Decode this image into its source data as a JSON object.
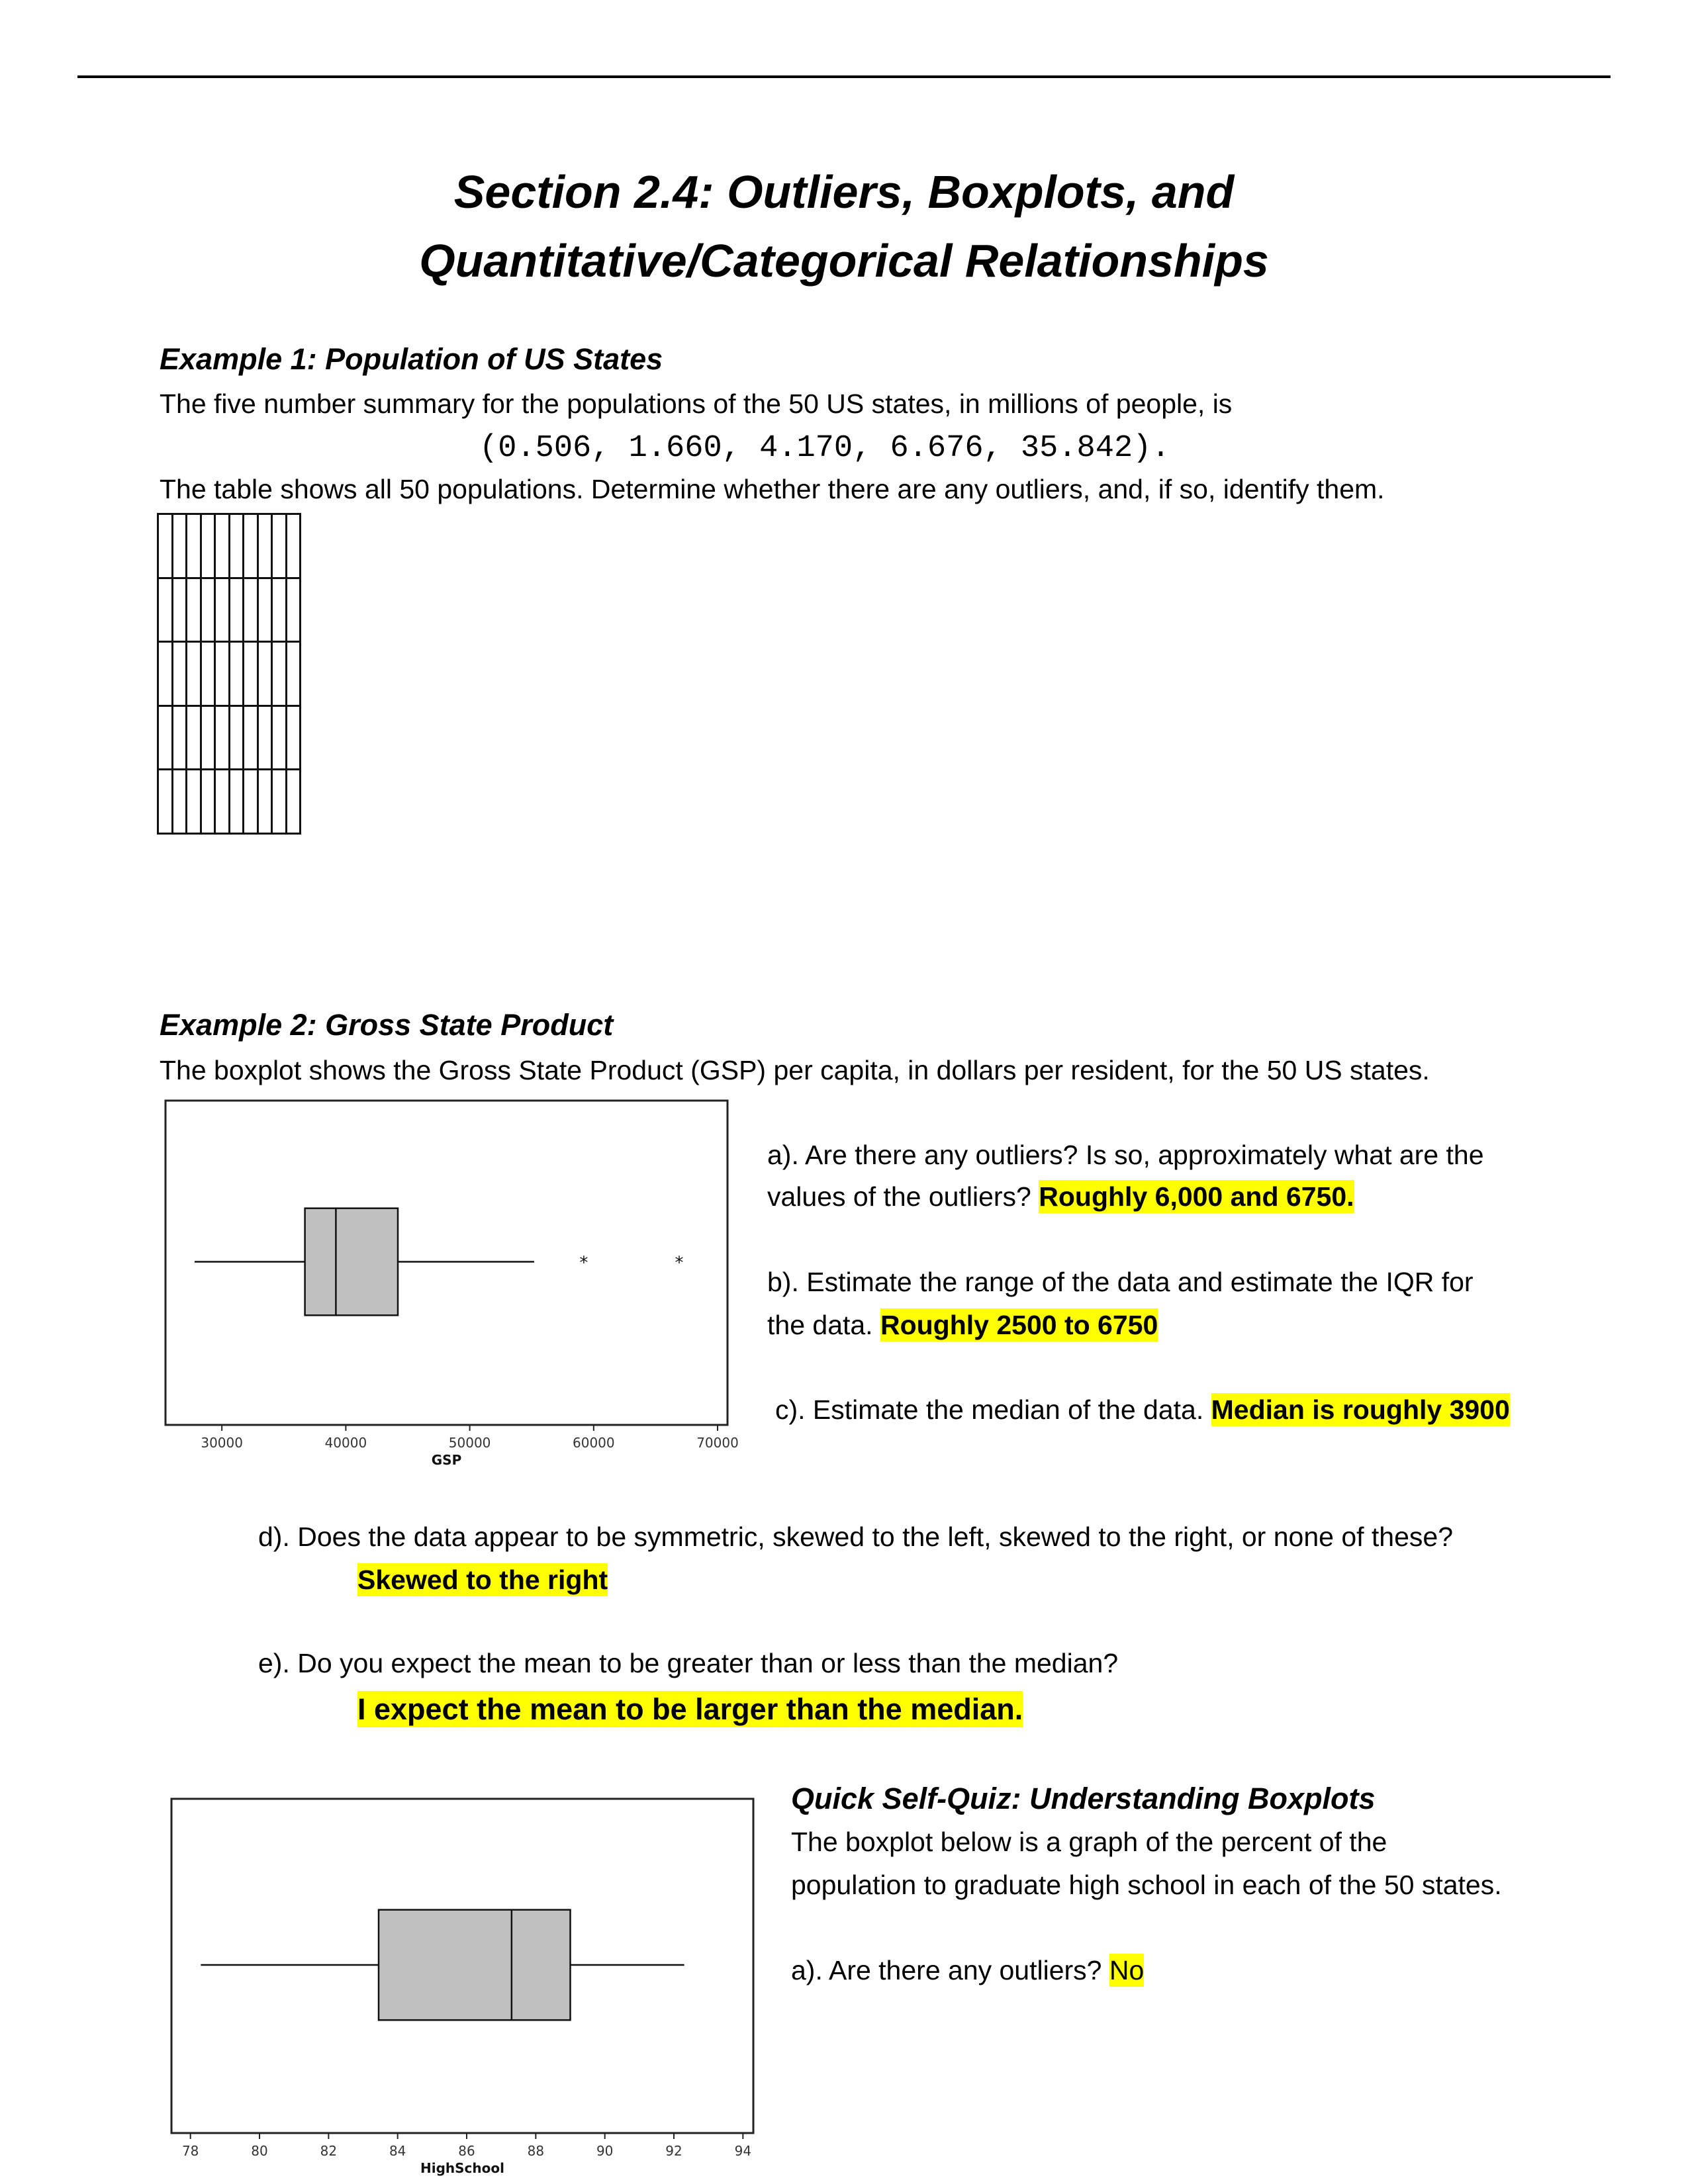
{
  "header": {
    "title_line1": "Section 2.4:  Outliers, Boxplots, and",
    "title_line2": "Quantitative/Categorical Relationships"
  },
  "example1": {
    "heading": "Example 1:  Population of US States",
    "intro": "The five number summary for the populations of the 50 US states, in millions of people, is",
    "five_number_summary": "(0.506, 1.660, 4.170, 6.676, 35.842).",
    "instruction": "The table shows all 50 populations.  Determine whether there are any outliers, and, if so, identify them.",
    "table": {
      "rows": 5,
      "columns": 10,
      "cells": []
    }
  },
  "example2": {
    "heading": "Example 2:  Gross State Product",
    "intro": "The boxplot shows the Gross State Product (GSP) per capita, in dollars per resident, for the 50 US states.",
    "questions": {
      "a_line1": "a).  Are there any outliers?  Is so, approximately what are the",
      "a_line2": "values of the outliers?",
      "a_answer": "Roughly 6,000 and 6750.",
      "b_line1": "b).  Estimate the range of the data and estimate the IQR for",
      "b_line2": "the data.",
      "b_answer": "Roughly 2500 to 6750",
      "c_text": "c).  Estimate the median of the data.",
      "c_answer": "Median is roughly 3900",
      "d_text": "d).  Does the data appear to be symmetric, skewed to the left, skewed to the right, or none of these?",
      "d_answer": "Skewed to the right",
      "e_text": "e).  Do you expect the mean to be greater than or less than the median?",
      "e_answer": "I expect the mean to be larger than the median."
    }
  },
  "quiz": {
    "heading": "Quick Self-Quiz:  Understanding Boxplots",
    "line1": "The boxplot below is a graph of the percent of the",
    "line2": "population to graduate high school in each of the 50 states.",
    "a_text": "a).  Are there any outliers?",
    "a_answer": "No"
  },
  "colors": {
    "highlight": "#ffff00",
    "box_fill": "#c0c0c0"
  },
  "chart_data": [
    {
      "type": "boxplot",
      "name": "gsp",
      "title": "",
      "xlabel": "GSP",
      "ylabel": "",
      "xlim": [
        25450,
        70800
      ],
      "ticks": [
        30000,
        40000,
        50000,
        60000,
        70000
      ],
      "tick_labels": [
        "30000",
        "40000",
        "50000",
        "60000",
        "70000"
      ],
      "whisker_low": 27800,
      "q1": 36700,
      "median": 39200,
      "q3": 44200,
      "whisker_high": 55200,
      "outliers": [
        59200,
        66900
      ],
      "outlier_marker": "*",
      "grid": false
    },
    {
      "type": "boxplot",
      "name": "highschool",
      "title": "",
      "xlabel": "HighSchool",
      "ylabel": "",
      "xlim": [
        77.45,
        94.3
      ],
      "ticks": [
        78,
        80,
        82,
        84,
        86,
        88,
        90,
        92,
        94
      ],
      "tick_labels": [
        "78",
        "80",
        "82",
        "84",
        "86",
        "88",
        "90",
        "92",
        "94"
      ],
      "whisker_low": 78.3,
      "q1": 83.45,
      "median": 87.3,
      "q3": 89.0,
      "whisker_high": 92.3,
      "outliers": [],
      "grid": false
    }
  ]
}
